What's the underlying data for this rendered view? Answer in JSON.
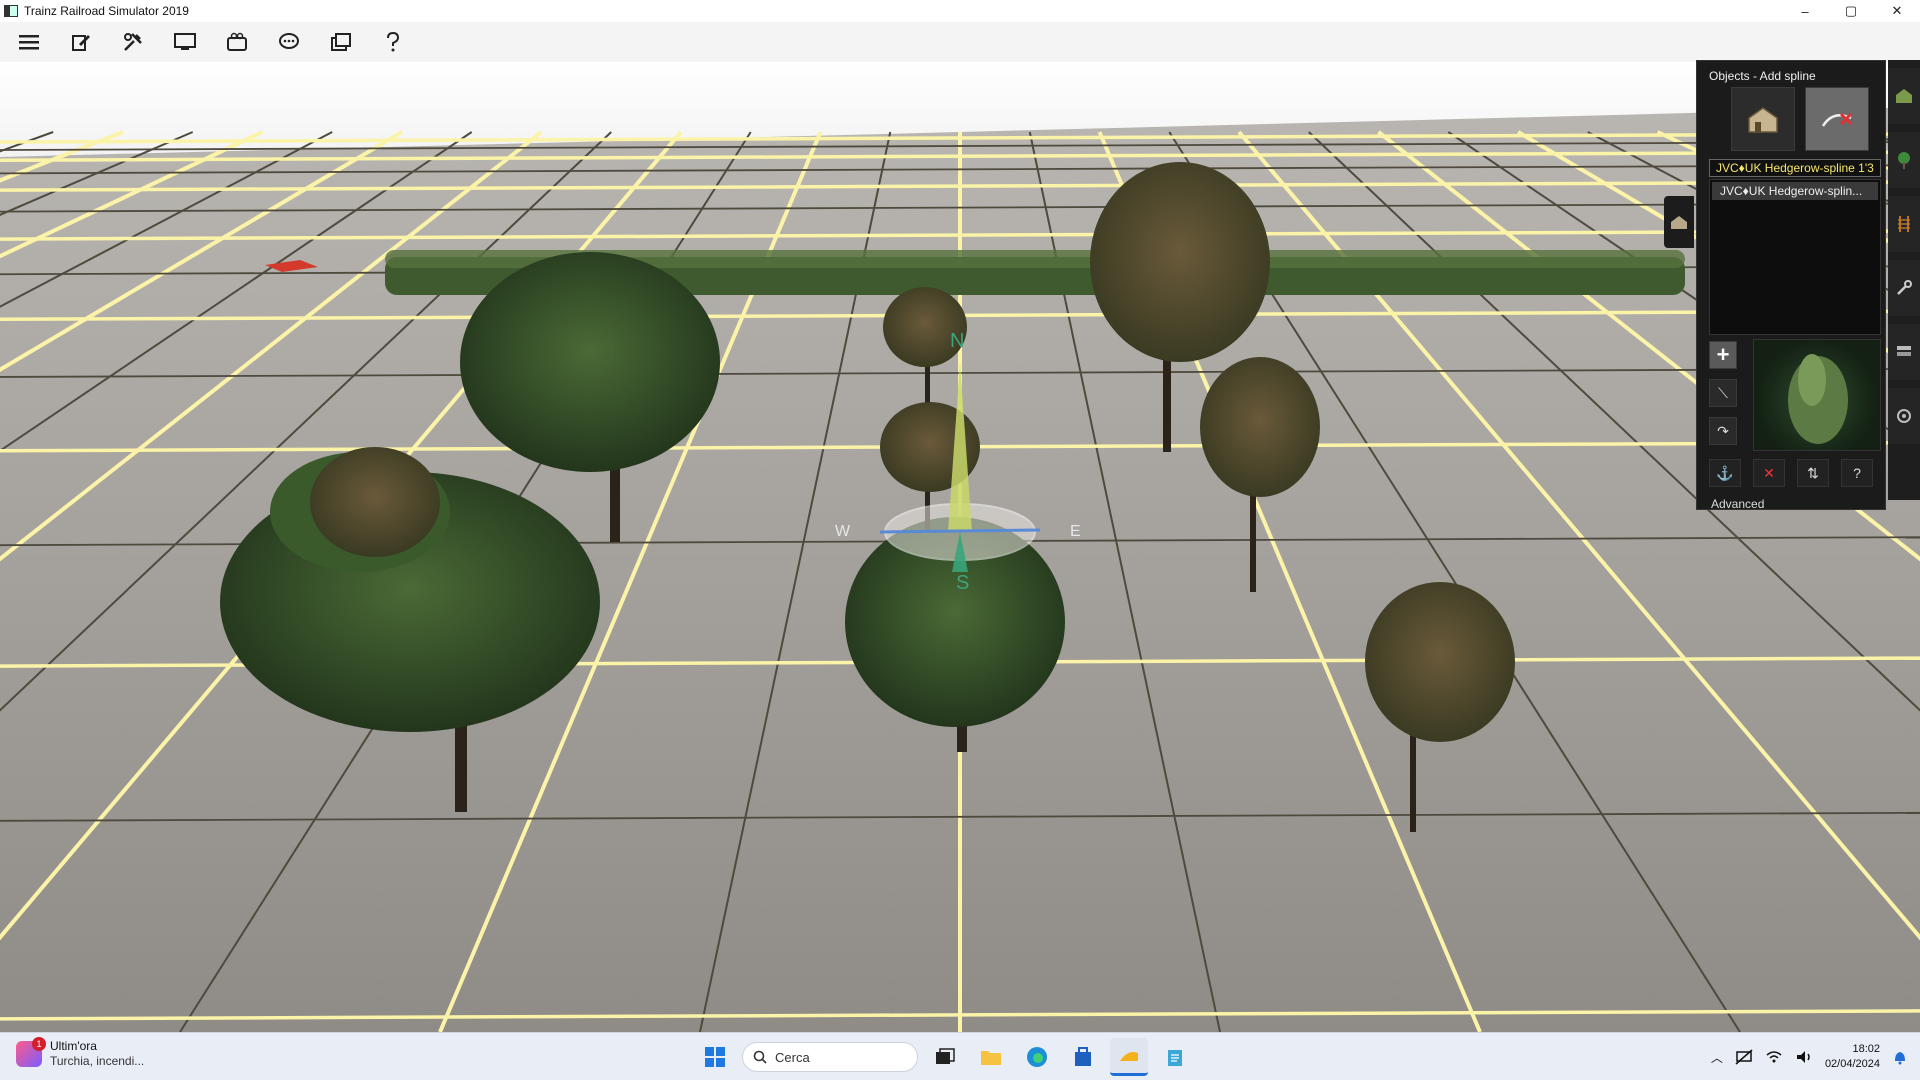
{
  "window": {
    "title": "Trainz Railroad Simulator 2019",
    "controls": {
      "minimize": "–",
      "maximize": "▢",
      "close": "✕"
    }
  },
  "toolbar": {
    "items": [
      {
        "icon": "menu-icon"
      },
      {
        "icon": "edit-icon"
      },
      {
        "icon": "tools-icon"
      },
      {
        "icon": "monitor-icon"
      },
      {
        "icon": "camera-icon"
      },
      {
        "icon": "chat-icon"
      },
      {
        "icon": "layers-icon"
      },
      {
        "icon": "help-icon"
      }
    ]
  },
  "viewport": {
    "compass": {
      "north": "N",
      "south": "S",
      "east": "E",
      "west": "W"
    }
  },
  "objects_panel": {
    "title": "Objects - Add spline",
    "modes": [
      {
        "icon": "house-icon",
        "active": false
      },
      {
        "icon": "spline-icon",
        "active": true
      }
    ],
    "selected_asset": "JVC♦UK Hedgerow-spline 1'3",
    "asset_list": [
      "JVC♦UK Hedgerow-splin..."
    ],
    "tools": [
      {
        "icon": "add-icon",
        "label": "+"
      },
      {
        "icon": "brush-icon",
        "label": "⟍"
      },
      {
        "icon": "rotate-icon",
        "label": "↷"
      }
    ],
    "bottom_tools": [
      {
        "icon": "anchor-icon",
        "label": "⚓"
      },
      {
        "icon": "delete-icon",
        "label": "✕"
      },
      {
        "icon": "split-icon",
        "label": "⇅"
      },
      {
        "icon": "help-icon",
        "label": "?"
      }
    ],
    "advanced_label": "Advanced"
  },
  "taskbar": {
    "news_title": "Ultim'ora",
    "news_sub": "Turchia, incendi...",
    "news_badge": "1",
    "search_placeholder": "Cerca",
    "time": "18:02",
    "date": "02/04/2024"
  },
  "colors": {
    "ground": "#9e9a95",
    "gridline": "#fbf3a8",
    "panel": "#1b1b1b",
    "accent_text": "#f5e56b"
  }
}
